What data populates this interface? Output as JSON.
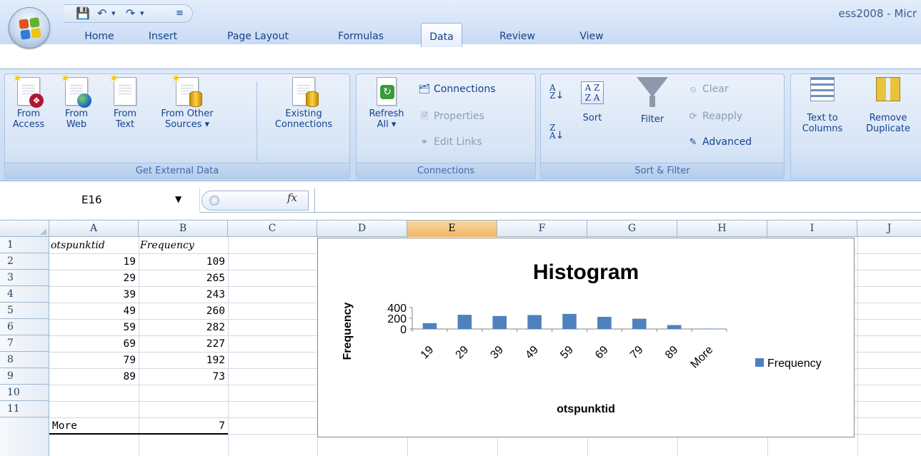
{
  "window": {
    "title": "ess2008 - Micr"
  },
  "tabs": [
    {
      "label": "Home"
    },
    {
      "label": "Insert"
    },
    {
      "label": "Page Layout"
    },
    {
      "label": "Formulas"
    },
    {
      "label": "Data",
      "active": true
    },
    {
      "label": "Review"
    },
    {
      "label": "View"
    }
  ],
  "ribbon": {
    "get_external_data": {
      "label": "Get External Data",
      "from_access": "From\nAccess",
      "from_web": "From\nWeb",
      "from_text": "From\nText",
      "from_other_sources": "From Other\nSources ▾",
      "existing_connections": "Existing\nConnections"
    },
    "connections": {
      "label": "Connections",
      "refresh_all": "Refresh\nAll ▾",
      "connections": "Connections",
      "properties": "Properties",
      "edit_links": "Edit Links"
    },
    "sort_filter": {
      "label": "Sort & Filter",
      "sort": "Sort",
      "filter": "Filter",
      "clear": "Clear",
      "reapply": "Reapply",
      "advanced": "Advanced"
    },
    "data_tools": {
      "text_to_columns": "Text to\nColumns",
      "remove_duplicates": "Remove\nDuplicate"
    }
  },
  "formula_bar": {
    "name_box": "E16",
    "formula": "",
    "fx_symbol": "fx"
  },
  "columns": [
    "A",
    "B",
    "C",
    "D",
    "E",
    "F",
    "G",
    "H",
    "I",
    "J"
  ],
  "selected_column": "E",
  "rows": [
    "1",
    "2",
    "3",
    "4",
    "5",
    "6",
    "7",
    "8",
    "9",
    "10",
    "11"
  ],
  "sheet": {
    "header": {
      "a": "otspunktid",
      "b": "Frequency"
    },
    "data": [
      {
        "a": "19",
        "b": "109"
      },
      {
        "a": "29",
        "b": "265"
      },
      {
        "a": "39",
        "b": "243"
      },
      {
        "a": "49",
        "b": "260"
      },
      {
        "a": "59",
        "b": "282"
      },
      {
        "a": "69",
        "b": "227"
      },
      {
        "a": "79",
        "b": "192"
      },
      {
        "a": "89",
        "b": "73"
      },
      {
        "a": "More",
        "b": "7"
      }
    ]
  },
  "colors": {
    "series": "#4f81bd",
    "selected_header": "#f6c27a",
    "ribbon": "#c6d9f1"
  },
  "chart_data": {
    "type": "bar",
    "title": "Histogram",
    "xlabel": "otspunktid",
    "ylabel": "Frequency",
    "categories": [
      "19",
      "29",
      "39",
      "49",
      "59",
      "69",
      "79",
      "89",
      "More"
    ],
    "series": [
      {
        "name": "Frequency",
        "values": [
          109,
          265,
          243,
          260,
          282,
          227,
          192,
          73,
          7
        ]
      }
    ],
    "yticks": [
      "0",
      "200",
      "400"
    ],
    "ylim": [
      0,
      400
    ],
    "legend": "right"
  }
}
